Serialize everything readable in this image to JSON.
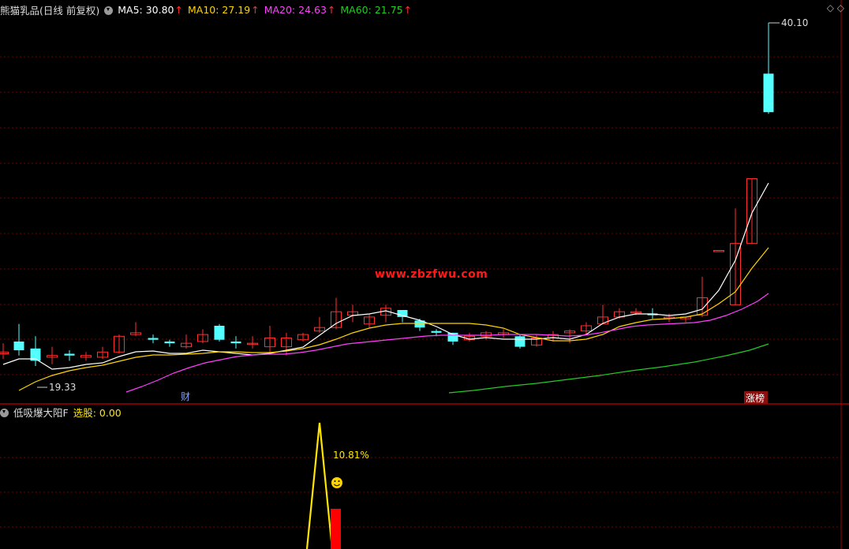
{
  "header": {
    "title": "熊猫乳品(日线 前复权)",
    "ma": [
      {
        "label": "MA5: 30.80",
        "color": "#ffffff",
        "arrow": "↑"
      },
      {
        "label": "MA10: 27.19",
        "color": "#ffd400",
        "arrow": "↑"
      },
      {
        "label": "MA20: 24.63",
        "color": "#ff40ff",
        "arrow": "↑"
      },
      {
        "label": "MA60: 21.75",
        "color": "#22cc22",
        "arrow": "↑"
      }
    ],
    "controls": "◇ ◇"
  },
  "price_labels": {
    "high": "40.10",
    "low": "19.33"
  },
  "watermark": "www.zbzfwu.com",
  "badges": {
    "cai": "财",
    "zhangbang": "涨榜"
  },
  "indicator": {
    "name": "低吸爆大阳F",
    "value_label": "选股: 0.00",
    "annotation": "10.81%",
    "face_icon": "smiley-icon"
  },
  "colors": {
    "up": "#ff3030",
    "down": "#54ffff",
    "ma5": "#ffffff",
    "ma10": "#ffd400",
    "ma20": "#ff40ff",
    "ma60": "#22cc22",
    "grid": "#7a0000",
    "indicator_line": "#ffe600",
    "indicator_bar": "#ff0000"
  }
}
